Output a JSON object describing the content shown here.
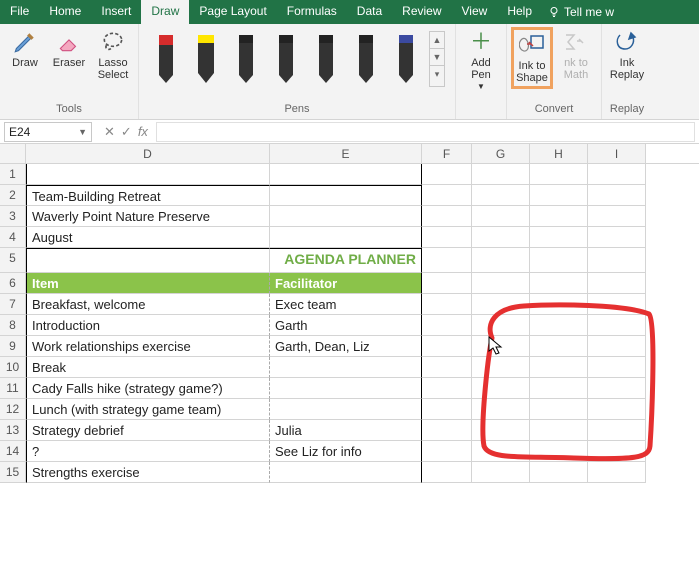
{
  "menu": {
    "tabs": [
      "File",
      "Home",
      "Insert",
      "Draw",
      "Page Layout",
      "Formulas",
      "Data",
      "Review",
      "View",
      "Help"
    ],
    "active": "Draw",
    "tell": "Tell me w"
  },
  "ribbon": {
    "tools": {
      "draw": "Draw",
      "eraser": "Eraser",
      "lasso": "Lasso Select",
      "label": "Tools"
    },
    "pens": {
      "label": "Pens"
    },
    "addpen": "Add Pen",
    "inkToShape": "Ink to Shape",
    "inkToMath": "nk to Math",
    "inkReplay": "Ink Replay",
    "convert": "Convert",
    "replay": "Replay"
  },
  "namebox": "E24",
  "columns": [
    "D",
    "E",
    "F",
    "G",
    "H",
    "I"
  ],
  "sheet": {
    "r2d": "Team-Building Retreat",
    "r3d": "Waverly Point Nature Preserve",
    "r4d": "August",
    "r5": "AGENDA PLANNER",
    "r6d": "Item",
    "r6e": "Facilitator",
    "r7d": "Breakfast, welcome",
    "r7e": "Exec team",
    "r8d": "Introduction",
    "r8e": "Garth",
    "r9d": "Work relationships exercise",
    "r9e": "Garth, Dean, Liz",
    "r10d": "Break",
    "r11d": "Cady Falls hike (strategy game?)",
    "r12d": "Lunch (with strategy game team)",
    "r13d": "Strategy debrief",
    "r13e": "Julia",
    "r14d": "?",
    "r14e": "See Liz for info",
    "r15d": "Strengths exercise"
  },
  "rownums": [
    "1",
    "2",
    "3",
    "4",
    "5",
    "6",
    "7",
    "8",
    "9",
    "10",
    "11",
    "12",
    "13",
    "14",
    "15"
  ]
}
